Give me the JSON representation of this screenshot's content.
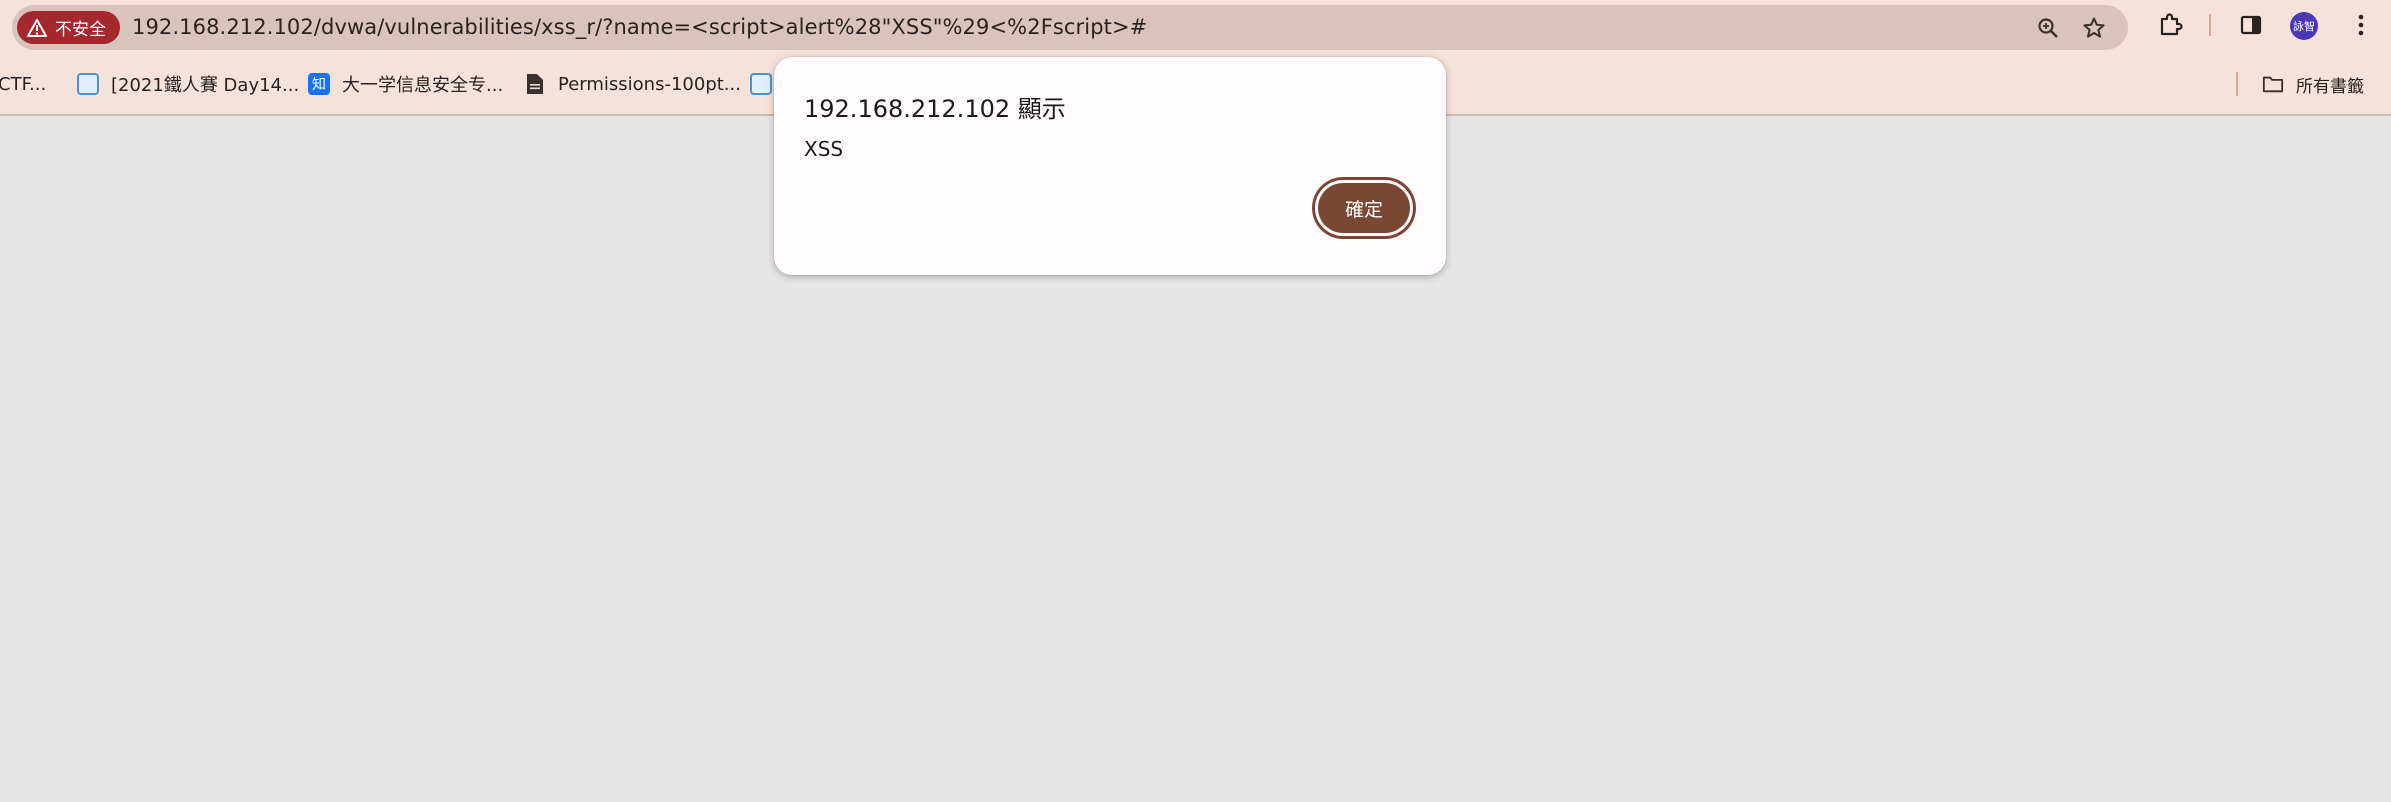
{
  "address_bar": {
    "security_label": "不安全",
    "url": "192.168.212.102/dvwa/vulnerabilities/xss_r/?name=<script>alert%28\"XSS\"%29<%2Fscript>#"
  },
  "profile": {
    "avatar_text": "詠智"
  },
  "bookmarks": {
    "items": [
      {
        "label": "CTF...",
        "icon": "document-icon"
      },
      {
        "label": "[2021鐵人賽 Day14...",
        "icon": "ithome-icon"
      },
      {
        "label": "大一学信息安全专...",
        "icon": "zhihu-icon"
      },
      {
        "label": "Permissions-100pt...",
        "icon": "document-icon"
      },
      {
        "label": "",
        "icon": "ithome-icon"
      }
    ],
    "all_bookmarks_label": "所有書籤"
  },
  "dialog": {
    "title": "192.168.212.102 顯示",
    "message": "XSS",
    "ok_label": "確定"
  },
  "colors": {
    "chrome_frame": "#f5e2db",
    "omnibox": "#d9c4bd",
    "insecure_chip": "#a4282d",
    "dialog_button": "#7b4735",
    "page_background": "#e6e6e6"
  }
}
